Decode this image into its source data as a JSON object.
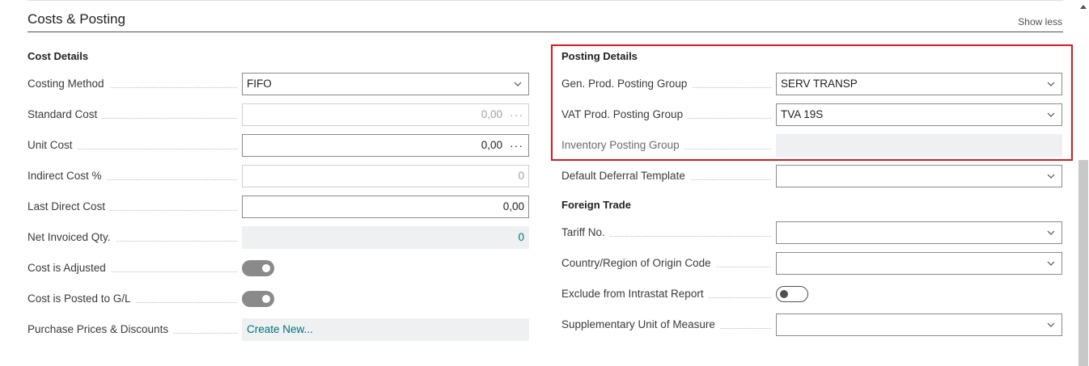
{
  "section": {
    "title": "Costs & Posting",
    "show_less": "Show less"
  },
  "cost_details": {
    "title": "Cost Details",
    "costing_method": {
      "label": "Costing Method",
      "value": "FIFO"
    },
    "standard_cost": {
      "label": "Standard Cost",
      "value": "0,00",
      "ellipsis": "···"
    },
    "unit_cost": {
      "label": "Unit Cost",
      "value": "0,00",
      "ellipsis": "···"
    },
    "indirect_cost": {
      "label": "Indirect Cost %",
      "value": "0"
    },
    "last_direct_cost": {
      "label": "Last Direct Cost",
      "value": "0,00"
    },
    "net_invoiced_qty": {
      "label": "Net Invoiced Qty.",
      "value": "0"
    },
    "cost_is_adjusted": {
      "label": "Cost is Adjusted",
      "state": "on"
    },
    "cost_is_posted": {
      "label": "Cost is Posted to G/L",
      "state": "on"
    },
    "purchase_prices": {
      "label": "Purchase Prices & Discounts",
      "value": "Create New..."
    }
  },
  "posting_details": {
    "title": "Posting Details",
    "gen_prod": {
      "label": "Gen. Prod. Posting Group",
      "value": "SERV TRANSP"
    },
    "vat_prod": {
      "label": "VAT Prod. Posting Group",
      "value": "TVA 19S"
    },
    "inventory": {
      "label": "Inventory Posting Group",
      "value": ""
    },
    "deferral": {
      "label": "Default Deferral Template",
      "value": ""
    }
  },
  "foreign_trade": {
    "title": "Foreign Trade",
    "tariff": {
      "label": "Tariff No.",
      "value": ""
    },
    "country": {
      "label": "Country/Region of Origin Code",
      "value": ""
    },
    "exclude_intrastat": {
      "label": "Exclude from Intrastat Report",
      "state": "off"
    },
    "supp_unit": {
      "label": "Supplementary Unit of Measure",
      "value": ""
    }
  },
  "colors": {
    "highlight": "#d71920",
    "link": "#00727a"
  }
}
